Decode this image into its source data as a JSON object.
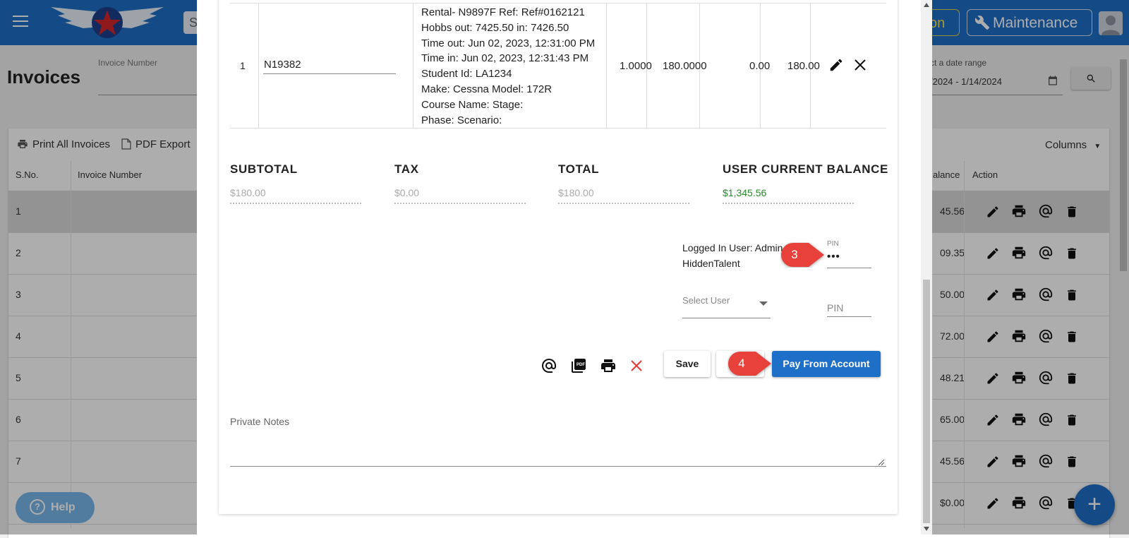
{
  "header": {
    "search_placeholder": "S",
    "yellow_button_label": "on",
    "maintenance_label": "Maintenance"
  },
  "page": {
    "title": "Invoices",
    "invoice_number_label": "Invoice Number",
    "date_range_label": "ct a date range",
    "date_range_value": "/2024 - 1/14/2024"
  },
  "toolbar": {
    "print_all": "Print All Invoices",
    "pdf_export": "PDF Export",
    "columns": "Columns"
  },
  "table": {
    "headers": {
      "sno": "S.No.",
      "invoice_number": "Invoice Number",
      "balance": "alance",
      "action": "Action"
    },
    "rows": [
      {
        "sno": "1",
        "balance": "45.56"
      },
      {
        "sno": "2",
        "balance": "09.35"
      },
      {
        "sno": "3",
        "balance": "50.00"
      },
      {
        "sno": "4",
        "balance": "72.00"
      },
      {
        "sno": "5",
        "balance": "48.21"
      },
      {
        "sno": "6",
        "balance": "65.00"
      },
      {
        "sno": "7",
        "balance": "45.56"
      },
      {
        "sno": "",
        "balance": "$0.00"
      }
    ]
  },
  "help": {
    "label": "Help"
  },
  "fab": {
    "label": "+"
  },
  "modal": {
    "line_item": {
      "number": "1",
      "tail_number": "N19382",
      "description": [
        "Rental- N9897F Ref: Ref#0162121",
        "Hobbs out: 7425.50 in: 7426.50",
        "Time out: Jun 02, 2023, 12:31:00 PM",
        "Time in: Jun 02, 2023, 12:31:43 PM",
        "Student Id: LA1234",
        "Make: Cessna Model: 172R",
        "Course Name: Stage:",
        "Phase: Scenario:"
      ],
      "quantity": "1.0000",
      "rate": "180.0000",
      "discount": "0.00",
      "amount": "180.00"
    },
    "summary": {
      "subtotal_label": "SUBTOTAL",
      "subtotal_value": "$180.00",
      "tax_label": "TAX",
      "tax_value": "$0.00",
      "total_label": "TOTAL",
      "total_value": "$180.00",
      "balance_label": "USER CURRENT BALANCE",
      "balance_value": "$1,345.56"
    },
    "auth": {
      "logged_in_line1": "Logged In User: Admin",
      "logged_in_line2": "HiddenTalent",
      "pin_label": "PIN",
      "pin_value": "•••",
      "select_user_label": "Select User",
      "pin2_placeholder": "PIN"
    },
    "actions": {
      "save": "Save",
      "pay": "Pay From Account"
    },
    "callouts": {
      "step3": "3",
      "step4": "4"
    },
    "private_notes_label": "Private Notes"
  },
  "colors": {
    "primary": "#1e6fc8",
    "balance_green": "#2a8a2a",
    "callout_red": "#e8413c",
    "cancel_red": "#e53935"
  }
}
